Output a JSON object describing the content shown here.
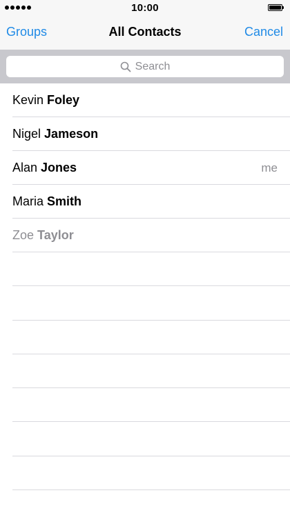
{
  "status_bar": {
    "time": "10:00",
    "signal_icon": "signal-dots-icon",
    "battery_icon": "battery-icon",
    "battery_level": 1.0
  },
  "nav": {
    "left_label": "Groups",
    "title": "All Contacts",
    "right_label": "Cancel",
    "accent_color": "#1f8ae6"
  },
  "search": {
    "placeholder": "Search",
    "icon": "search-icon"
  },
  "contacts": [
    {
      "first": "Kevin",
      "last": "Foley",
      "tag": ""
    },
    {
      "first": "Nigel",
      "last": "Jameson",
      "tag": ""
    },
    {
      "first": "Alan",
      "last": "Jones",
      "tag": "me"
    },
    {
      "first": "Maria",
      "last": "Smith",
      "tag": ""
    },
    {
      "first": "Zoe",
      "last": "Taylor",
      "tag": ""
    }
  ]
}
